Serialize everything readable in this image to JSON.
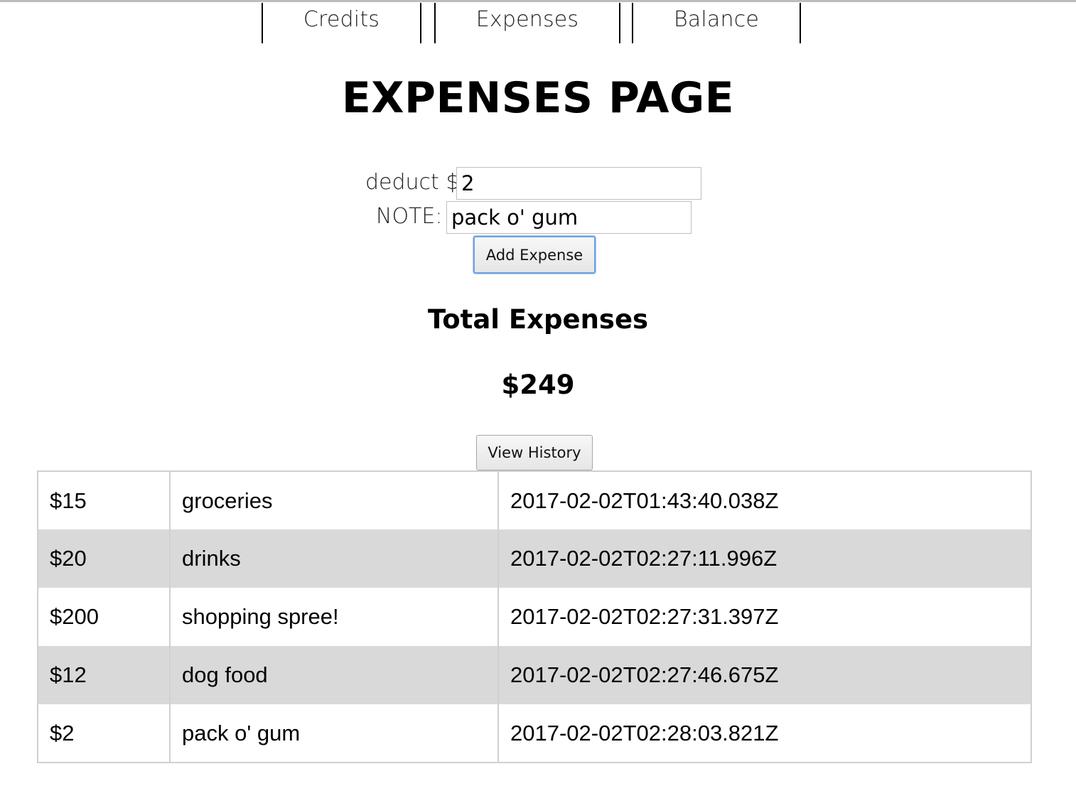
{
  "nav": {
    "credits": "Credits",
    "expenses": "Expenses",
    "balance": "Balance"
  },
  "page_title": "EXPENSES PAGE",
  "form": {
    "deduct_label": "deduct $",
    "deduct_value": "2",
    "note_label": "NOTE:",
    "note_value": "pack o' gum",
    "add_button": "Add Expense"
  },
  "totals": {
    "heading": "Total Expenses",
    "value": "$249"
  },
  "view_history_button": "View History",
  "history": [
    {
      "amount": "$15",
      "note": "groceries",
      "timestamp": "2017-02-02T01:43:40.038Z"
    },
    {
      "amount": "$20",
      "note": "drinks",
      "timestamp": "2017-02-02T02:27:11.996Z"
    },
    {
      "amount": "$200",
      "note": "shopping spree!",
      "timestamp": "2017-02-02T02:27:31.397Z"
    },
    {
      "amount": "$12",
      "note": "dog food",
      "timestamp": "2017-02-02T02:27:46.675Z"
    },
    {
      "amount": "$2",
      "note": "pack o' gum",
      "timestamp": "2017-02-02T02:28:03.821Z"
    }
  ],
  "colors": {
    "row_alt": "#d9d9d9",
    "focus_ring": "#6fa3e0"
  }
}
